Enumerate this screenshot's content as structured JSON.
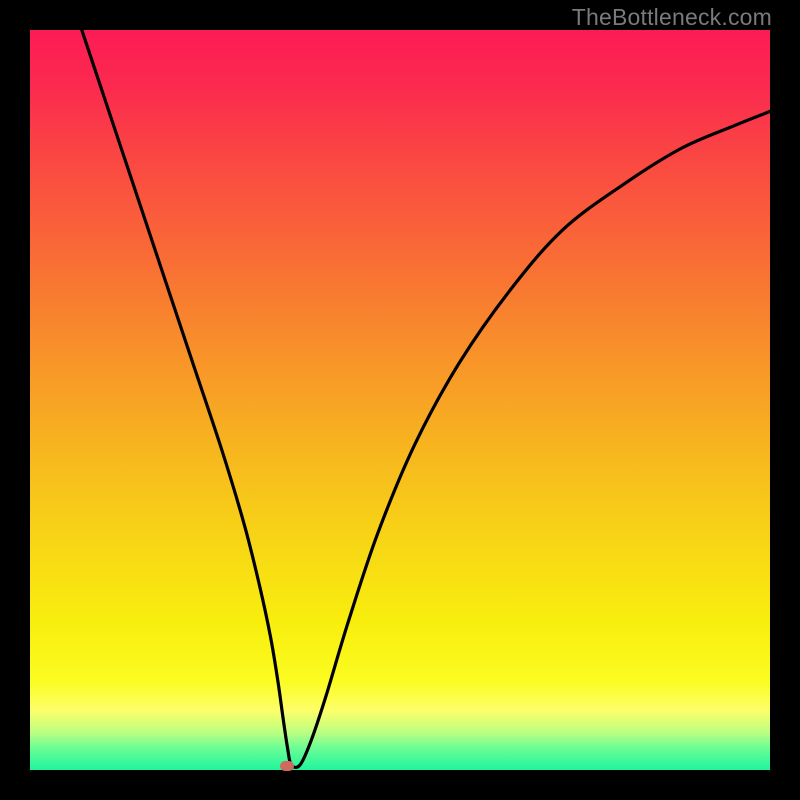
{
  "watermark": "TheBottleneck.com",
  "colors": {
    "frame_bg": "#000000",
    "watermark_text": "#7a7a7a",
    "curve_stroke": "#000000",
    "marker_fill": "#cf6a5f",
    "gradient_stops": [
      "#fc1b55",
      "#fb2b4e",
      "#fa4942",
      "#f96a36",
      "#f88d2b",
      "#f7b120",
      "#f7d316",
      "#f8ee0e",
      "#fbfc21",
      "#fcff6b",
      "#b9ff82",
      "#6cfd95",
      "#1ff59d"
    ]
  },
  "chart_data": {
    "type": "line",
    "title": "",
    "xlabel": "",
    "ylabel": "",
    "xlim": [
      0,
      100
    ],
    "ylim": [
      0,
      100
    ],
    "grid": false,
    "series": [
      {
        "name": "curve",
        "x": [
          7,
          10,
          14,
          18,
          22,
          26,
          29,
          31,
          32.5,
          33.5,
          34.2,
          34.8,
          35.3,
          36.5,
          38,
          40,
          43,
          47,
          52,
          58,
          65,
          72,
          80,
          88,
          95,
          100
        ],
        "y": [
          100,
          91,
          79,
          67,
          55,
          43,
          33,
          25,
          18,
          12,
          7,
          3,
          0.7,
          0.7,
          4,
          10,
          20,
          32,
          44,
          55,
          65,
          73,
          79,
          84,
          87,
          89
        ]
      }
    ],
    "marker": {
      "x": 34.7,
      "y": 0.6
    }
  }
}
